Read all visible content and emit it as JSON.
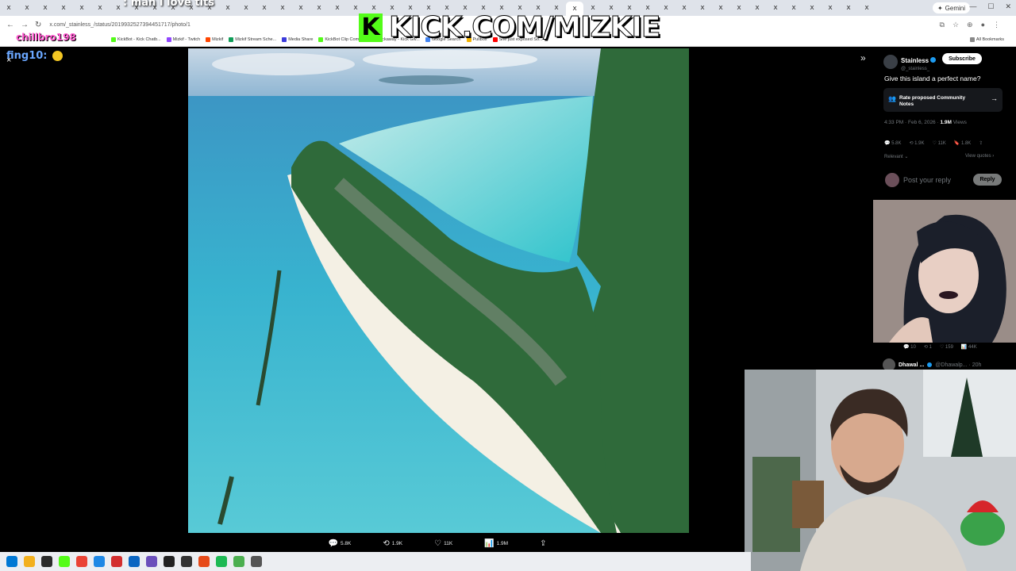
{
  "browser": {
    "tabs": [
      "x",
      "x",
      "x",
      "x",
      "x",
      "x",
      "x",
      "x",
      "x",
      "x",
      "x",
      "x",
      "x",
      "x",
      "x",
      "x",
      "x",
      "x",
      "x",
      "x",
      "x",
      "x",
      "x",
      "x",
      "x",
      "x",
      "x",
      "x",
      "x",
      "x",
      "x",
      "x",
      "x",
      "x",
      "x",
      "x",
      "x",
      "x",
      "x",
      "x",
      "x",
      "x",
      "x",
      "x",
      "x",
      "x",
      "x",
      "x"
    ],
    "active_tab_index": 31,
    "gemini_label": "Gemini",
    "url": "x.com/_stainless_/status/2019932527394451717/photo/1",
    "bookmarks": [
      {
        "label": "KickBot - Kick Chatb...",
        "color": "#53fc18"
      },
      {
        "label": "Mizkif - Twitch",
        "color": "#9146ff"
      },
      {
        "label": "Mizkif",
        "color": "#ff4500"
      },
      {
        "label": "Mizkif Stream Sche...",
        "color": "#0f9d58"
      },
      {
        "label": "Media Share",
        "color": "#3b3bdb"
      },
      {
        "label": "KickBot Clip Comm...",
        "color": "#53fc18"
      },
      {
        "label": "Kickaway - Kick Giv...",
        "color": "#000000"
      },
      {
        "label": "Google Search",
        "color": "#4285f4"
      },
      {
        "label": "Pullbox",
        "color": "#f4b400"
      },
      {
        "label": "She just exposed So...",
        "color": "#ff0000"
      }
    ],
    "all_bookmarks": "All Bookmarks"
  },
  "overlay": {
    "kick_logo": "K",
    "kick_url": "KICK.COM/MIZKIE",
    "chat_line": ": man I love tits",
    "chat_name": "chillbro198",
    "viewer_name": "fing10:"
  },
  "photo_viewer": {
    "close_icon": "×",
    "actions": [
      {
        "icon": "reply-icon",
        "glyph": "💬",
        "count": "5.8K"
      },
      {
        "icon": "repost-icon",
        "glyph": "⟲",
        "count": "1.9K"
      },
      {
        "icon": "like-icon",
        "glyph": "♡",
        "count": "11K"
      },
      {
        "icon": "views-icon",
        "glyph": "📊",
        "count": "1.9M"
      },
      {
        "icon": "share-icon",
        "glyph": "⇪",
        "count": ""
      }
    ]
  },
  "tweet": {
    "author": "Stainless",
    "handle": "@_stainless_",
    "subscribe_label": "Subscribe",
    "text": "Give this island a perfect name?",
    "community_notes": "Rate proposed Community Notes",
    "timestamp": "4:33 PM · Feb 6, 2026 · ",
    "views": "1.9M",
    "views_label": " Views",
    "stats": [
      "5.8K",
      "1.9K",
      "11K",
      "1.8K"
    ],
    "relevant_label": "Relevant",
    "view_quotes_label": "View quotes",
    "reply_placeholder": "Post your reply",
    "reply_button": "Reply"
  },
  "side_reply": {
    "stats": [
      "10",
      "1",
      "159",
      "44K"
    ],
    "next_author": "Dhawal ...",
    "next_handle": "@Dhawalp... · 20h"
  },
  "colors": {
    "kick_green": "#53fc18",
    "x_blue": "#1d9bf0",
    "sea": "#3bc5d6",
    "forest": "#2f6a3a"
  }
}
